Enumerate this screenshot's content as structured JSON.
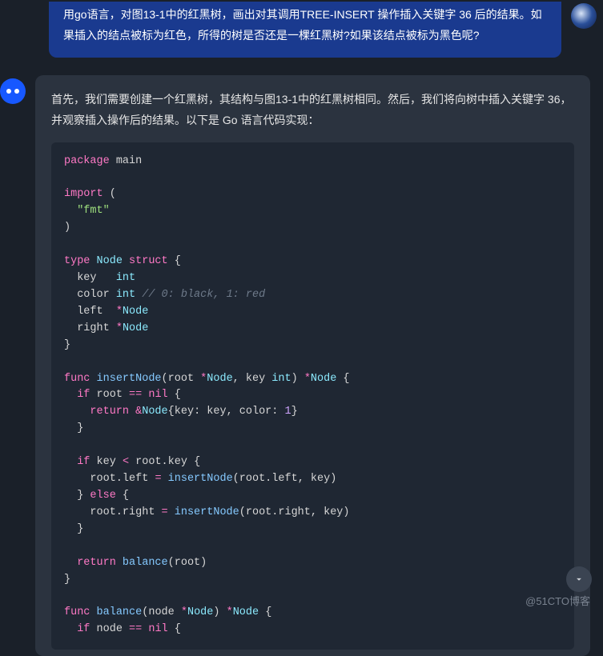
{
  "user": {
    "prompt": "用go语言，对图13-1中的红黑树，画出对其调用TREE-INSERT 操作插入关键字 36 后的结果。如果插入的结点被标为红色，所得的树是否还是一棵红黑树?如果该结点被标为黑色呢?"
  },
  "assistant": {
    "intro": "首先，我们需要创建一个红黑树，其结构与图13-1中的红黑树相同。然后，我们将向树中插入关键字 36，并观察插入操作后的结果。以下是 Go 语言代码实现："
  },
  "code": {
    "kw_package": "package",
    "pkg_main": "main",
    "kw_import": "import",
    "str_fmt": "\"fmt\"",
    "kw_type": "type",
    "typ_node": "Node",
    "kw_struct": "struct",
    "fld_key": "key",
    "typ_int": "int",
    "fld_color": "color",
    "cmt_color": "// 0: black, 1: red",
    "fld_left": "left",
    "ptr_node": "*Node",
    "fld_right": "right",
    "kw_func": "func",
    "fn_insert": "insertNode",
    "param_root": "root",
    "param_key": "key",
    "kw_if": "if",
    "kw_nil": "nil",
    "kw_return": "return",
    "amp_node": "&Node",
    "lit_key": "key",
    "lit_color": "color",
    "num_1": "1",
    "op_lt": "<",
    "op_eqeq": "==",
    "op_assign": "=",
    "dot_key": "root.key",
    "dot_left": "root.left",
    "dot_right": "root.right",
    "kw_else": "else",
    "fn_balance": "balance",
    "param_node": "node"
  },
  "watermark": "@51CTO博客"
}
